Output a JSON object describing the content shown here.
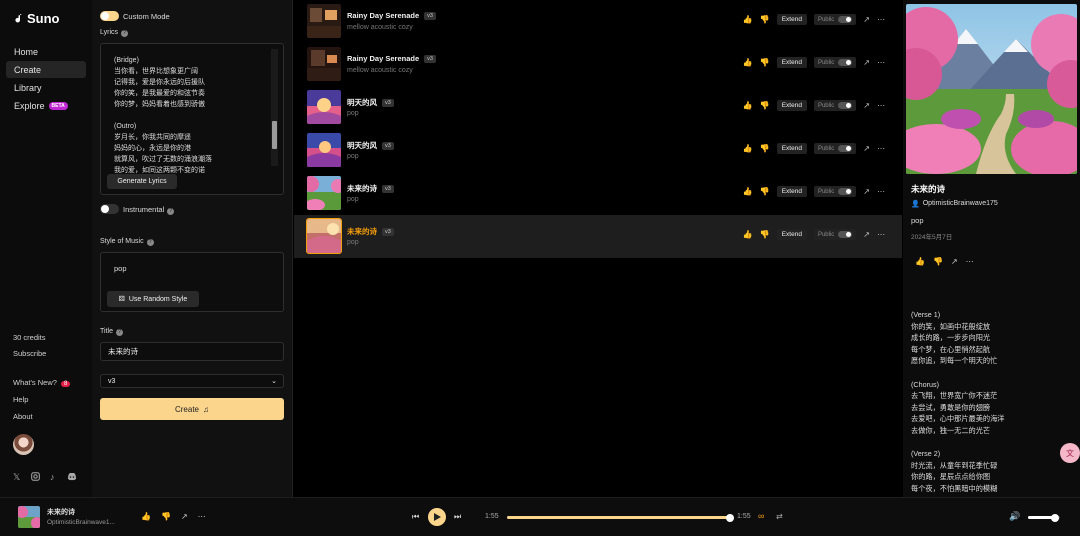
{
  "sidebar": {
    "logo": "Suno",
    "nav": [
      {
        "label": "Home"
      },
      {
        "label": "Create"
      },
      {
        "label": "Library"
      },
      {
        "label": "Explore",
        "badge": "BETA"
      }
    ],
    "credits": "30 credits",
    "subscribe": "Subscribe",
    "whats_new": "What's New?",
    "whats_new_count": "8",
    "help": "Help",
    "about": "About",
    "social_icons": [
      "x-icon",
      "instagram-icon",
      "tiktok-icon",
      "discord-icon"
    ]
  },
  "create": {
    "custom_mode": "Custom Mode",
    "lyrics_label": "Lyrics",
    "lyrics_text": "(Bridge)\n当你看，世界比想象更广阔\n记得我，爱是你永远的后援队\n你的笑，是我最爱的和弦节奏\n你的梦，妈妈看着也感到骄傲\n\n(Outro)\n岁月长，你我共同的摩遥\n妈妈的心，永远是你的港\n就算风，吹过了无数的涌浪潮落\n我的爱，如同这两颗不变的诺",
    "generate_lyrics": "Generate Lyrics",
    "instrumental": "Instrumental",
    "style_label": "Style of Music",
    "style_value": "pop",
    "random_style": "Use Random Style",
    "title_label": "Title",
    "title_value": "未来的诗",
    "version": "v3",
    "create_button": "Create"
  },
  "songs": [
    {
      "title": "Rainy Day Serenade",
      "version": "v3",
      "style": "mellow acoustic cozy",
      "extend": "Extend",
      "public": "Public"
    },
    {
      "title": "Rainy Day Serenade",
      "version": "v3",
      "style": "mellow acoustic cozy",
      "extend": "Extend",
      "public": "Public"
    },
    {
      "title": "明天的风",
      "version": "v3",
      "style": "pop",
      "extend": "Extend",
      "public": "Public"
    },
    {
      "title": "明天的风",
      "version": "v3",
      "style": "pop",
      "extend": "Extend",
      "public": "Public"
    },
    {
      "title": "未来的诗",
      "version": "v3",
      "style": "pop",
      "extend": "Extend",
      "public": "Public"
    },
    {
      "title": "未来的诗",
      "version": "v3",
      "style": "pop",
      "extend": "Extend",
      "public": "Public"
    }
  ],
  "detail": {
    "title": "未来的诗",
    "author": "OptimisticBrainwave175",
    "style": "pop",
    "date": "2024年5月7日",
    "lyrics": "(Verse 1)\n你的笑，如画中花般绽放\n成长的路，一步步向阳光\n每个梦，在心里悄然起航\n愿你追，到每一个明天的忙\n\n(Chorus)\n去飞翔，世界宽广你不迷茫\n去尝试，勇敢是你的翅膀\n去爱吧，心中那片最美的海洋\n去做你，独一无二的光芒\n\n(Verse 2)\n时光流，从童年到花季忙碌\n你的路，星辰点点给你图\n每个夜，不怕黑暗中的模糊"
  },
  "player": {
    "title": "未来的诗",
    "author": "OptimisticBrainwave1...",
    "time_current": "1:55",
    "time_total": "1:55",
    "progress": 1.0,
    "volume": 0.85
  },
  "colors": {
    "accent": "#fcd58c",
    "highlight": "#f59e0b",
    "beta": "#c026d3",
    "badge": "#e11d48"
  }
}
